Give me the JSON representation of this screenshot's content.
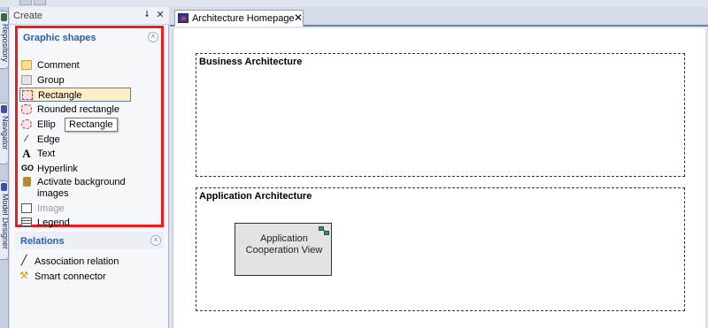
{
  "panel": {
    "title": "Create",
    "pin_glyph": "⭣",
    "close_glyph": "✕"
  },
  "vertical_tabs": [
    {
      "label": "Repository"
    },
    {
      "label": "Navigator"
    },
    {
      "label": "Model Designer"
    }
  ],
  "graphic_shapes": {
    "title": "Graphic shapes",
    "collapse_glyph": "˄",
    "items": [
      {
        "label": "Comment",
        "icon": "folder-icon"
      },
      {
        "label": "Group",
        "icon": "folder-gray-icon"
      },
      {
        "label": "Rectangle",
        "icon": "rectangle-icon"
      },
      {
        "label": "Rounded rectangle",
        "icon": "rounded-rectangle-icon"
      },
      {
        "label": "Ellip",
        "icon": "ellipse-icon"
      },
      {
        "label": "Edge",
        "icon": "edge-icon",
        "glyph": "⁄"
      },
      {
        "label": "Text",
        "icon": "text-icon",
        "glyph": "A"
      },
      {
        "label": "Hyperlink",
        "icon": "hyperlink-icon",
        "glyph": "GO"
      },
      {
        "label": "Activate background images",
        "icon": "background-image-icon"
      },
      {
        "label": "Image",
        "icon": "image-icon",
        "glyph": "▣"
      },
      {
        "label": "Legend",
        "icon": "legend-icon"
      }
    ]
  },
  "tooltip": {
    "text": "Rectangle"
  },
  "relations": {
    "title": "Relations",
    "collapse_glyph": "˄",
    "items": [
      {
        "label": "Association relation",
        "icon": "association-icon",
        "glyph": "╱"
      },
      {
        "label": "Smart connector",
        "icon": "smart-connector-icon",
        "glyph": "⚒"
      }
    ]
  },
  "document": {
    "tab_label": "Architecture Homepage",
    "tab_close": "✕",
    "areas": [
      {
        "title": "Business Architecture"
      },
      {
        "title": "Application Architecture",
        "object": {
          "label": "Application Cooperation View"
        }
      }
    ]
  },
  "colors": {
    "highlight_border": "#ee1c1c",
    "selected_item_bg": "#ffefc8",
    "group_title": "#2a5db0"
  }
}
